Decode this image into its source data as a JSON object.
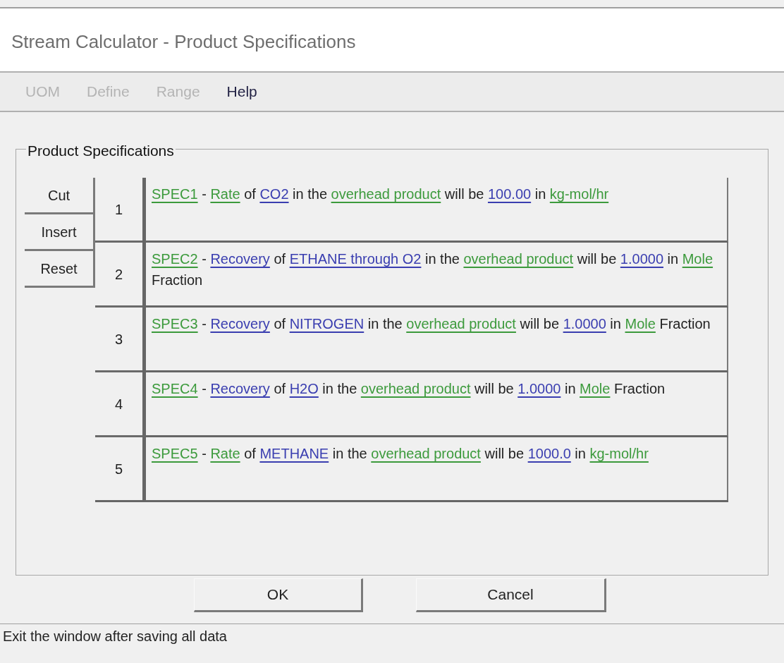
{
  "window": {
    "title": "Stream Calculator - Product Specifications"
  },
  "menu": [
    {
      "label": "UOM",
      "disabled": true
    },
    {
      "label": "Define",
      "disabled": true
    },
    {
      "label": "Range",
      "disabled": true
    },
    {
      "label": "Help",
      "disabled": false
    }
  ],
  "group": {
    "title": "Product Specifications"
  },
  "side_buttons": [
    "Cut",
    "Insert",
    "Reset"
  ],
  "specs": [
    {
      "number": "1",
      "segments": [
        {
          "kind": "link",
          "text": "SPEC1",
          "color": "#3c9a3c"
        },
        {
          "kind": "plain",
          "text": " - "
        },
        {
          "kind": "link",
          "text": "Rate",
          "color": "#3c9a3c"
        },
        {
          "kind": "plain",
          "text": " of "
        },
        {
          "kind": "link",
          "text": "CO2",
          "color": "#3a3eb0"
        },
        {
          "kind": "plain",
          "text": " in the "
        },
        {
          "kind": "link",
          "text": "overhead product",
          "color": "#3c9a3c"
        },
        {
          "kind": "plain",
          "text": " will be "
        },
        {
          "kind": "link",
          "text": "100.00",
          "color": "#3a3eb0"
        },
        {
          "kind": "plain",
          "text": " in "
        },
        {
          "kind": "link",
          "text": "kg-mol/hr",
          "color": "#3c9a3c"
        }
      ]
    },
    {
      "number": "2",
      "segments": [
        {
          "kind": "link",
          "text": "SPEC2",
          "color": "#3c9a3c"
        },
        {
          "kind": "plain",
          "text": " - "
        },
        {
          "kind": "link",
          "text": "Recovery",
          "color": "#3a3eb0"
        },
        {
          "kind": "plain",
          "text": " of "
        },
        {
          "kind": "link",
          "text": "ETHANE through O2",
          "color": "#3a3eb0"
        },
        {
          "kind": "plain",
          "text": " in the "
        },
        {
          "kind": "link",
          "text": "overhead product",
          "color": "#3c9a3c"
        },
        {
          "kind": "plain",
          "text": " will be "
        },
        {
          "kind": "link",
          "text": "1.0000",
          "color": "#3a3eb0"
        },
        {
          "kind": "plain",
          "text": " in "
        },
        {
          "kind": "link",
          "text": "Mole",
          "color": "#3c9a3c"
        },
        {
          "kind": "plain",
          "text": " Fraction"
        }
      ]
    },
    {
      "number": "3",
      "segments": [
        {
          "kind": "link",
          "text": "SPEC3",
          "color": "#3c9a3c"
        },
        {
          "kind": "plain",
          "text": " - "
        },
        {
          "kind": "link",
          "text": "Recovery",
          "color": "#3a3eb0"
        },
        {
          "kind": "plain",
          "text": " of "
        },
        {
          "kind": "link",
          "text": "NITROGEN",
          "color": "#3a3eb0"
        },
        {
          "kind": "plain",
          "text": " in the "
        },
        {
          "kind": "link",
          "text": "overhead product",
          "color": "#3c9a3c"
        },
        {
          "kind": "plain",
          "text": " will be "
        },
        {
          "kind": "link",
          "text": "1.0000",
          "color": "#3a3eb0"
        },
        {
          "kind": "plain",
          "text": " in "
        },
        {
          "kind": "link",
          "text": "Mole",
          "color": "#3c9a3c"
        },
        {
          "kind": "plain",
          "text": " Fraction"
        }
      ]
    },
    {
      "number": "4",
      "segments": [
        {
          "kind": "link",
          "text": "SPEC4",
          "color": "#3c9a3c"
        },
        {
          "kind": "plain",
          "text": " - "
        },
        {
          "kind": "link",
          "text": "Recovery",
          "color": "#3a3eb0"
        },
        {
          "kind": "plain",
          "text": " of "
        },
        {
          "kind": "link",
          "text": "H2O",
          "color": "#3a3eb0"
        },
        {
          "kind": "plain",
          "text": " in the "
        },
        {
          "kind": "link",
          "text": "overhead product",
          "color": "#3c9a3c"
        },
        {
          "kind": "plain",
          "text": " will be "
        },
        {
          "kind": "link",
          "text": "1.0000",
          "color": "#3a3eb0"
        },
        {
          "kind": "plain",
          "text": " in "
        },
        {
          "kind": "link",
          "text": "Mole",
          "color": "#3c9a3c"
        },
        {
          "kind": "plain",
          "text": " Fraction"
        }
      ]
    },
    {
      "number": "5",
      "segments": [
        {
          "kind": "link",
          "text": "SPEC5",
          "color": "#3c9a3c"
        },
        {
          "kind": "plain",
          "text": " - "
        },
        {
          "kind": "link",
          "text": "Rate",
          "color": "#3c9a3c"
        },
        {
          "kind": "plain",
          "text": " of "
        },
        {
          "kind": "link",
          "text": "METHANE",
          "color": "#3a3eb0"
        },
        {
          "kind": "plain",
          "text": " in the "
        },
        {
          "kind": "link",
          "text": "overhead product",
          "color": "#3c9a3c"
        },
        {
          "kind": "plain",
          "text": " will be "
        },
        {
          "kind": "link",
          "text": "1000.0",
          "color": "#3a3eb0"
        },
        {
          "kind": "plain",
          "text": " in "
        },
        {
          "kind": "link",
          "text": "kg-mol/hr",
          "color": "#3c9a3c"
        }
      ]
    }
  ],
  "buttons": [
    "OK",
    "Cancel"
  ],
  "status_bar": "Exit the window after saving all data"
}
